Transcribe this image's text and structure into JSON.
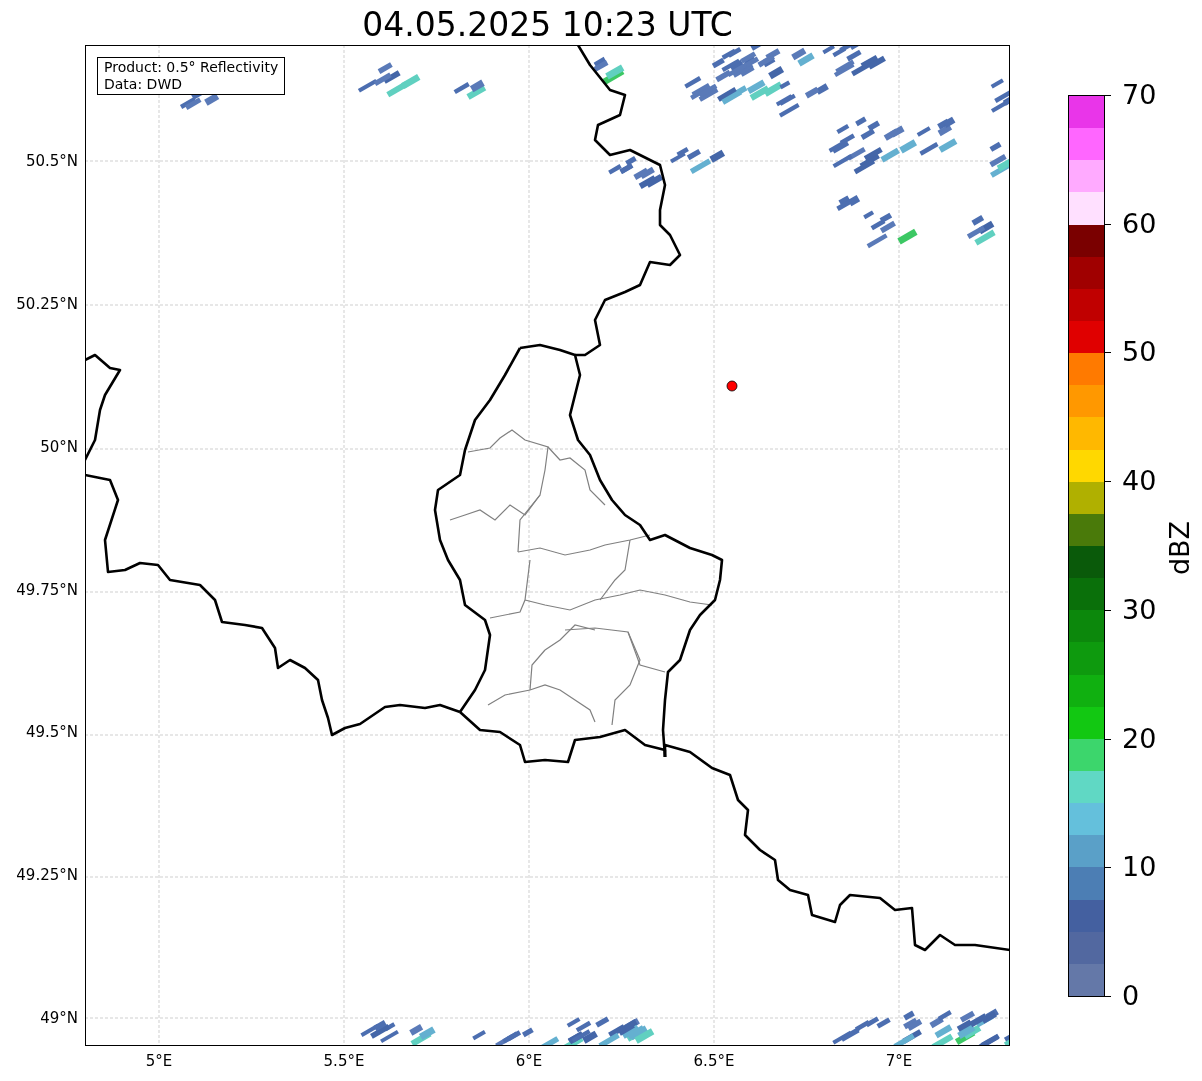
{
  "title": "04.05.2025 10:23 UTC",
  "info_box": {
    "lines": [
      "Product: 0.5° Reflectivity",
      "Data: DWD"
    ]
  },
  "lat_ticks": [
    "50.5°N",
    "50.25°N",
    "50°N",
    "49.75°N",
    "49.5°N",
    "49.25°N",
    "49°N"
  ],
  "lon_ticks": [
    "5°E",
    "5.5°E",
    "6°E",
    "6.5°E",
    "7°E"
  ],
  "colorbar": {
    "label": "dBZ",
    "ticks": [
      "70",
      "60",
      "50",
      "40",
      "30",
      "20",
      "10",
      "0"
    ],
    "segments": [
      {
        "color": "#6478a8"
      },
      {
        "color": "#5268a0"
      },
      {
        "color": "#4460a0"
      },
      {
        "color": "#4c7eb4"
      },
      {
        "color": "#5aa0c8"
      },
      {
        "color": "#64c0dc"
      },
      {
        "color": "#60d8c4"
      },
      {
        "color": "#3cd66c"
      },
      {
        "color": "#12c812"
      },
      {
        "color": "#10b010"
      },
      {
        "color": "#0e9a0e"
      },
      {
        "color": "#0c880c"
      },
      {
        "color": "#0a700a"
      },
      {
        "color": "#0a5a0a"
      },
      {
        "color": "#4a7a0a"
      },
      {
        "color": "#b0b000"
      },
      {
        "color": "#ffd800"
      },
      {
        "color": "#ffb800"
      },
      {
        "color": "#ff9800"
      },
      {
        "color": "#ff7a00"
      },
      {
        "color": "#e00000"
      },
      {
        "color": "#c00000"
      },
      {
        "color": "#a00000"
      },
      {
        "color": "#7a0000"
      },
      {
        "color": "#ffe0ff"
      },
      {
        "color": "#ffaaff"
      },
      {
        "color": "#ff66ff"
      },
      {
        "color": "#e935e9"
      }
    ]
  }
}
